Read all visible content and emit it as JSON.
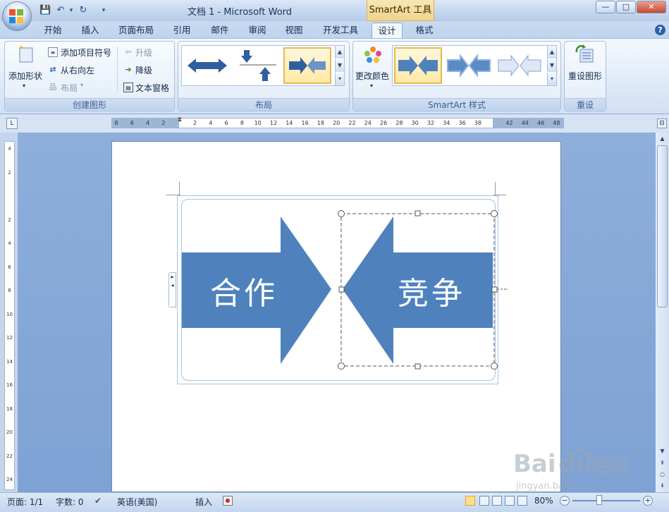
{
  "window": {
    "title": "文档 1 - Microsoft Word",
    "context_tab": "SmartArt 工具",
    "minimize": "—",
    "maximize": "□",
    "close": "✕"
  },
  "tabs": [
    {
      "label": "开始"
    },
    {
      "label": "插入"
    },
    {
      "label": "页面布局"
    },
    {
      "label": "引用"
    },
    {
      "label": "邮件"
    },
    {
      "label": "审阅"
    },
    {
      "label": "视图"
    },
    {
      "label": "开发工具"
    },
    {
      "label": "设计"
    },
    {
      "label": "格式"
    }
  ],
  "ribbon": {
    "create_group": {
      "label": "创建图形",
      "add_shape": "添加形状",
      "add_bullet": "添加项目符号",
      "right_to_left": "从右向左",
      "layout": "布局",
      "promote": "升级",
      "demote": "降级",
      "text_pane": "文本窗格"
    },
    "layout_group": {
      "label": "布局"
    },
    "styles_group": {
      "label": "SmartArt 样式",
      "change_colors": "更改颜色"
    },
    "reset_group": {
      "label": "重设",
      "reset_graphic": "重设图形"
    }
  },
  "ruler": {
    "h_labels": [
      "8",
      "6",
      "4",
      "2",
      "",
      "2",
      "4",
      "6",
      "8",
      "10",
      "12",
      "14",
      "16",
      "18",
      "20",
      "22",
      "24",
      "26",
      "28",
      "30",
      "32",
      "34",
      "36",
      "38",
      "",
      "42",
      "44",
      "46",
      "48"
    ],
    "v_labels": [
      "4",
      "2",
      "",
      "2",
      "4",
      "6",
      "8",
      "10",
      "12",
      "14",
      "16",
      "18",
      "20",
      "22",
      "24"
    ]
  },
  "smartart": {
    "left_text": "合作",
    "right_text": "竞争",
    "color": "#4f81bd"
  },
  "status": {
    "page": "页面: 1/1",
    "words": "字数: 0",
    "language": "英语(美国)",
    "mode": "插入",
    "zoom": "80%"
  },
  "watermark": {
    "brand": "Baidu经验",
    "url": "jingyan.baidu.com"
  }
}
